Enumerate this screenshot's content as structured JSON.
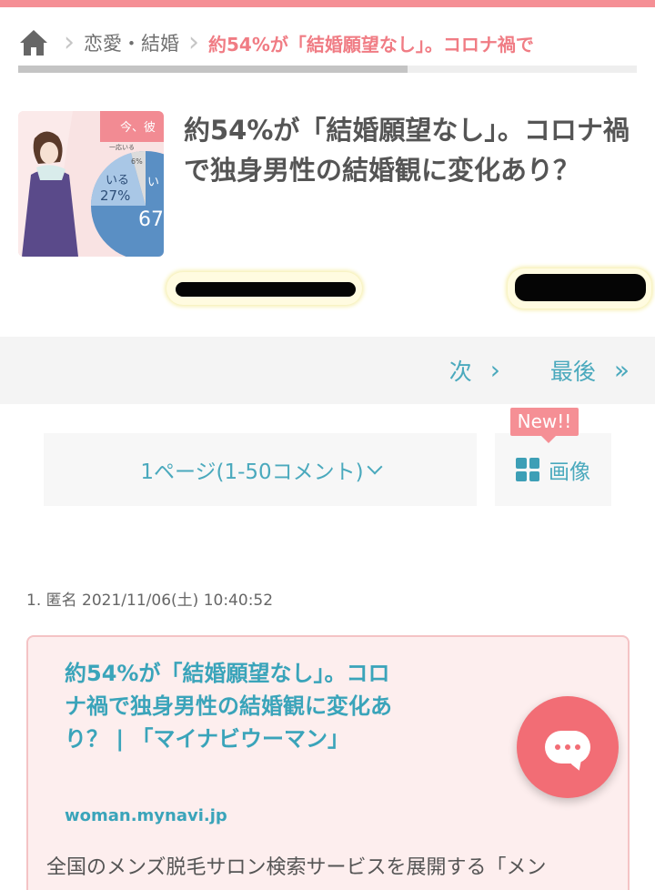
{
  "breadcrumb": {
    "category": "恋愛・結婚",
    "current": "約54%が「結婚願望なし」。コロナ禍で"
  },
  "article": {
    "title": "約54%が「結婚願望なし」。コロナ禍で独身男性の結婚観に変化あり？",
    "thumbnail": {
      "header_text": "今、彼",
      "label_small": "一応いる",
      "pct_small": "6%",
      "label_mid": "いる",
      "pct_mid": "27%",
      "pct_big": "67",
      "label_big": "い"
    }
  },
  "pager": {
    "next_label": "次",
    "last_label": "最後"
  },
  "page_select": {
    "label": "1ページ(1-50コメント)"
  },
  "image_button": {
    "label": "画像",
    "badge": "New!!"
  },
  "comment": {
    "number": "1.",
    "author": "匿名",
    "timestamp": "2021/11/06(土) 10:40:52"
  },
  "link_card": {
    "title": "約54%が「結婚願望なし」。コロナ禍で独身男性の結婚観に変化あり？ | 「マイナビウーマン」",
    "domain": "woman.mynavi.jp",
    "description": "全国のメンズ脱毛サロン検索サービスを展開する「メン"
  },
  "colors": {
    "accent": "#f58f95",
    "link": "#3aa4ba",
    "fab": "#f26d75"
  }
}
